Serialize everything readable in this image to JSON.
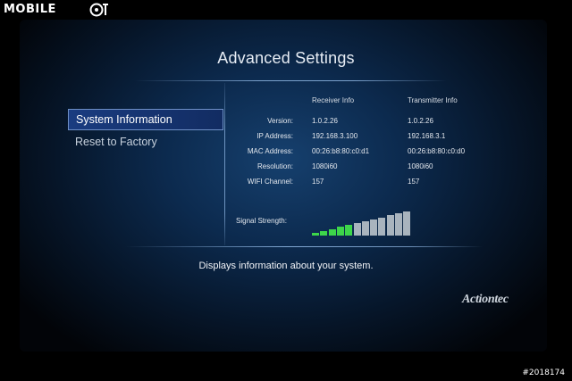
{
  "watermark": {
    "brand": "MOBILE",
    "id": "#2018174"
  },
  "page": {
    "title": "Advanced Settings"
  },
  "menu": {
    "items": [
      {
        "label": "System Information",
        "selected": true
      },
      {
        "label": "Reset to Factory",
        "selected": false
      }
    ]
  },
  "info": {
    "columns": [
      "Receiver Info",
      "Transmitter Info"
    ],
    "rows": [
      {
        "label": "Version:",
        "receiver": "1.0.2.26",
        "transmitter": "1.0.2.26"
      },
      {
        "label": "IP Address:",
        "receiver": "192.168.3.100",
        "transmitter": "192.168.3.1"
      },
      {
        "label": "MAC Address:",
        "receiver": "00:26:b8:80:c0:d1",
        "transmitter": "00:26:b8:80:c0:d0"
      },
      {
        "label": "Resolution:",
        "receiver": "1080i60",
        "transmitter": "1080i60"
      },
      {
        "label": "WIFI Channel:",
        "receiver": "157",
        "transmitter": "157"
      }
    ],
    "signal": {
      "label": "Signal Strength:",
      "level": 5,
      "max": 12,
      "on_color": "#3dd64a",
      "off_color": "#a9b4be"
    }
  },
  "footer": {
    "description": "Displays information about your system.",
    "brand": "Actiontec"
  },
  "colors": {
    "accent": "#1a3c80",
    "background": "#0c2a4e"
  }
}
